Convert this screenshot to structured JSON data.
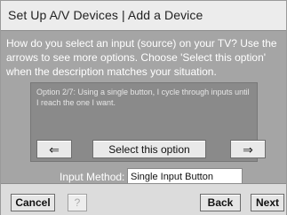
{
  "header": {
    "title": "Set Up A/V Devices | Add a Device"
  },
  "content": {
    "instructions": "How do you select an input (source) on your TV? Use the arrows to see more options. Choose 'Select this option' when the description matches your situation.",
    "option_text": "Option 2/7: Using a single button, I cycle through inputs until I reach the one I want.",
    "prev_icon": "left-arrow-icon",
    "next_icon": "right-arrow-icon",
    "prev_glyph": "⇐",
    "next_glyph": "⇒",
    "select_label": "Select this option",
    "input_method_label": "Input Method:",
    "input_method_value": "Single Input Button"
  },
  "footer": {
    "cancel_label": "Cancel",
    "help_label": "?",
    "back_label": "Back",
    "next_label": "Next"
  }
}
